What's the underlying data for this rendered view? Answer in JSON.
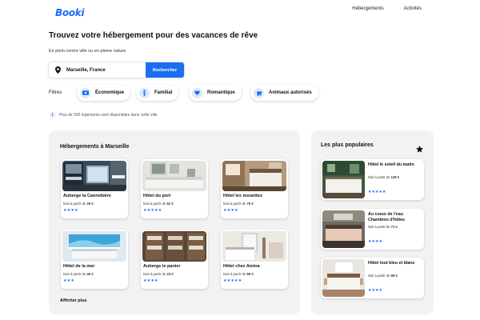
{
  "header": {
    "logo": "Booki",
    "nav": [
      "Hébergements",
      "Activités"
    ]
  },
  "hero": {
    "title": "Trouvez votre hébergement pour des vacances de rêve",
    "subtitle": "En plein centre ville ou en pleine nature"
  },
  "search": {
    "value": "Marseille, France",
    "button": "Rechercher",
    "icon": "map-pin-icon"
  },
  "filters": {
    "label": "Filtres",
    "items": [
      {
        "label": "Économique",
        "icon": "money-icon"
      },
      {
        "label": "Familial",
        "icon": "family-icon"
      },
      {
        "label": "Romantique",
        "icon": "heart-icon"
      },
      {
        "label": "Animaux autorisés",
        "icon": "dog-icon"
      }
    ]
  },
  "info": {
    "icon": "i",
    "text": "Plus de 500 logements sont disponibles dans cette ville"
  },
  "accommodations": {
    "title": "Hébergements à Marseille",
    "show_more": "Afficher plus",
    "items": [
      {
        "name": "Auberge la Cannebière",
        "price_prefix": "Nuit à partir de",
        "price": "25 €",
        "stars": "★★★★",
        "rating": 4
      },
      {
        "name": "Hôtel du port",
        "price_prefix": "Nuit à partir de",
        "price": "52 €",
        "stars": "★★★★★",
        "rating": 5
      },
      {
        "name": "Hôtel les mouettes",
        "price_prefix": "Nuit à partir de",
        "price": "76 €",
        "stars": "★★★★",
        "rating": 4
      },
      {
        "name": "Hôtel de la mer",
        "price_prefix": "Nuit à partir de",
        "price": "46 €",
        "stars": "★★★",
        "rating": 3
      },
      {
        "name": "Auberge le panier",
        "price_prefix": "Nuit à partir de",
        "price": "23 €",
        "stars": "★★★★",
        "rating": 4
      },
      {
        "name": "Hôtel chez Amina",
        "price_prefix": "Nuit à partir de",
        "price": "96 €",
        "stars": "★★★★★",
        "rating": 5
      }
    ]
  },
  "popular": {
    "title": "Les plus populaires",
    "icon": "star-icon",
    "items": [
      {
        "name": "Hôtel le soleil du matin",
        "price_prefix": "Nuit à partir de",
        "price": "128 €",
        "stars": "★★★★★",
        "rating": 5
      },
      {
        "name": "Au coeur de l'eau Chambres d'hôtes",
        "price_prefix": "Nuit à partir de",
        "price": "71 €",
        "stars": "★★★★",
        "rating": 4
      },
      {
        "name": "Hôtel tout bleu et blanc",
        "price_prefix": "Nuit à partir de",
        "price": "68 €",
        "stars": "★★★★",
        "rating": 4
      }
    ]
  },
  "colors": {
    "accent": "#1b6ef3",
    "chip_icon_bg": "#dce8fd",
    "panel_bg": "#f2f2f2"
  }
}
